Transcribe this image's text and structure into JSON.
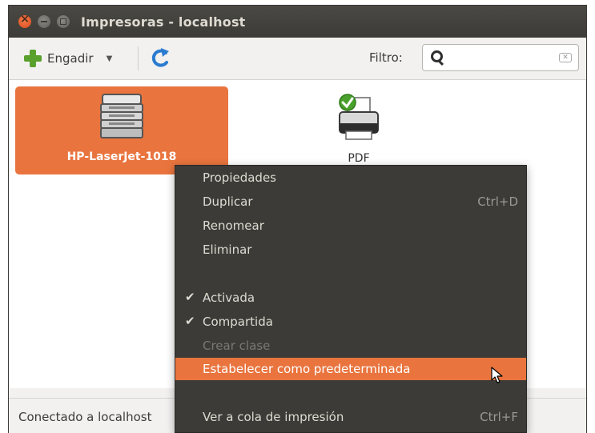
{
  "window": {
    "title": "Impresoras - localhost"
  },
  "toolbar": {
    "add_label": "Engadir",
    "filter_label": "Filtro:",
    "filter_value": ""
  },
  "printers": [
    {
      "name": "HP-LaserJet-1018",
      "selected": true,
      "default": false
    },
    {
      "name": "PDF",
      "selected": false,
      "default": true
    }
  ],
  "statusbar": {
    "text": "Conectado a localhost"
  },
  "context_menu": {
    "items": [
      {
        "label": "Propiedades",
        "shortcut": "",
        "checked": false,
        "enabled": true
      },
      {
        "label": "Duplicar",
        "shortcut": "Ctrl+D",
        "checked": false,
        "enabled": true
      },
      {
        "label": "Renomear",
        "shortcut": "",
        "checked": false,
        "enabled": true
      },
      {
        "label": "Eliminar",
        "shortcut": "",
        "checked": false,
        "enabled": true
      },
      {
        "label": "Activada",
        "shortcut": "",
        "checked": true,
        "enabled": true
      },
      {
        "label": "Compartida",
        "shortcut": "",
        "checked": true,
        "enabled": true
      },
      {
        "label": "Crear clase",
        "shortcut": "",
        "checked": false,
        "enabled": false
      },
      {
        "label": "Estabelecer como predeterminada",
        "shortcut": "",
        "checked": false,
        "enabled": true,
        "highlighted": true
      },
      {
        "label": "Ver a cola de impresión",
        "shortcut": "Ctrl+F",
        "checked": false,
        "enabled": true
      }
    ]
  },
  "colors": {
    "titlebar": "#3c3b37",
    "selection": "#e9743e",
    "menu_bg": "#3c3b37",
    "menu_text": "#dfdbd2"
  }
}
